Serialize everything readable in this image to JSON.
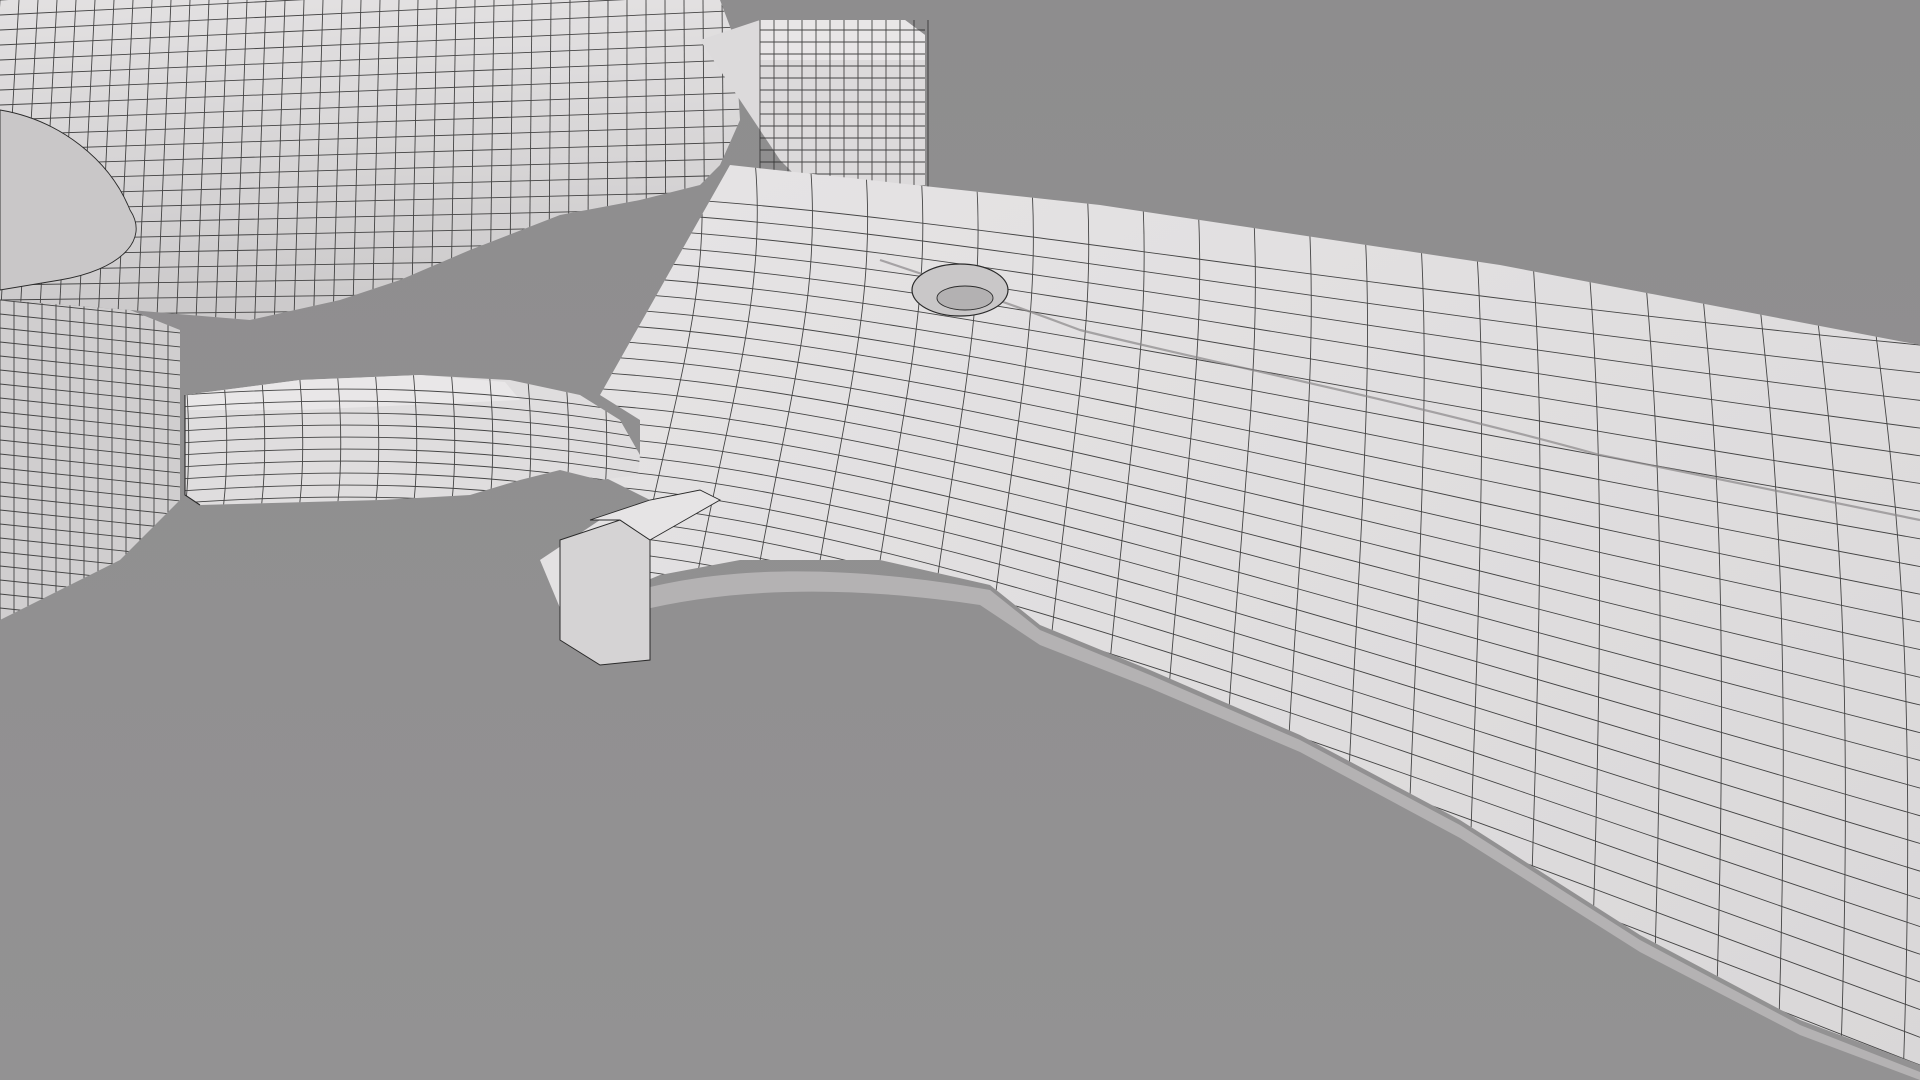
{
  "scene": {
    "subject": "wireframe-blade-mesh",
    "colors": {
      "background_top": "#8e8d8e",
      "background_bottom": "#939293",
      "mesh_top_face": "#e1dfe0",
      "mesh_side_face": "#cfcdce",
      "mesh_shadow_face": "#b9b7b8",
      "wire": "#2a2a2a",
      "edge_highlight": "#f1f0f0"
    }
  }
}
